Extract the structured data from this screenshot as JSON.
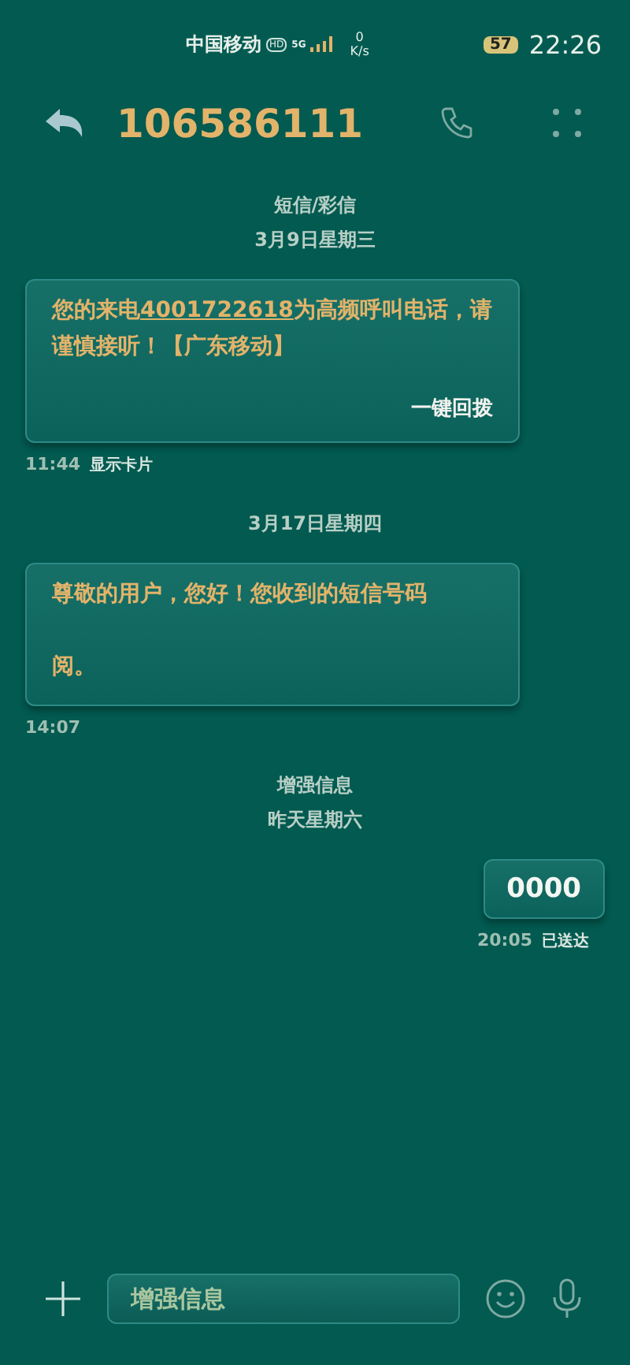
{
  "status_bar": {
    "carrier": "中国移动",
    "hd": "HD",
    "network": "5G",
    "speed_value": "0",
    "speed_unit": "K/s",
    "battery": "57",
    "time": "22:26"
  },
  "header": {
    "contact": "106586111"
  },
  "thread": [
    {
      "kind": "divider",
      "lines": [
        "短信/彩信",
        "3月9日星期三"
      ]
    },
    {
      "kind": "incoming",
      "parts": [
        "您的来电",
        "4001722618",
        "为高频呼叫电话，请谨慎接听！【广东移动】"
      ],
      "action": "一键回拨",
      "time": "11:44",
      "note": "显示卡片"
    },
    {
      "kind": "divider",
      "lines": [
        "3月17日星期四"
      ]
    },
    {
      "kind": "incoming",
      "lines": [
        "尊敬的用户，您好！您收到的短信号码",
        "阅。"
      ],
      "time": "14:07"
    },
    {
      "kind": "divider",
      "lines": [
        "增强信息",
        "昨天星期六"
      ]
    },
    {
      "kind": "outgoing",
      "text": "0000",
      "time": "20:05",
      "note": "已送达"
    }
  ],
  "composer": {
    "placeholder": "增强信息"
  }
}
